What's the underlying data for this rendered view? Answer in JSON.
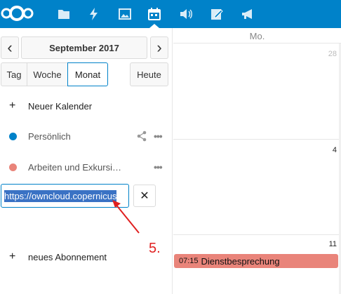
{
  "header": {
    "apps": [
      {
        "icon": "files-icon"
      },
      {
        "icon": "activity-icon"
      },
      {
        "icon": "gallery-icon"
      },
      {
        "icon": "calendar-icon"
      },
      {
        "icon": "audio-icon"
      },
      {
        "icon": "notes-icon"
      },
      {
        "icon": "announcements-icon"
      }
    ],
    "brand_color": "#0082c9"
  },
  "sidebar": {
    "prev_label": "‹",
    "next_label": "›",
    "current_date": "September 2017",
    "views": {
      "day": "Tag",
      "week": "Woche",
      "month": "Monat"
    },
    "today": "Heute",
    "new_calendar": "Neuer Kalender",
    "calendars": [
      {
        "label": "Persönlich",
        "color": "#0082c9"
      },
      {
        "label": "Arbeiten und Exkursi…",
        "color": "#e9847a"
      }
    ],
    "subscription_url": "https://owncloud.copernicus",
    "close_label": "✕",
    "new_subscription": "neues Abonnement",
    "annotation": "5."
  },
  "calendar": {
    "column_header": "Mo.",
    "days": [
      "28",
      "4",
      "11"
    ],
    "event": {
      "time": "07:15",
      "title": "Dienstbesprechung",
      "color": "#e9847a"
    }
  }
}
